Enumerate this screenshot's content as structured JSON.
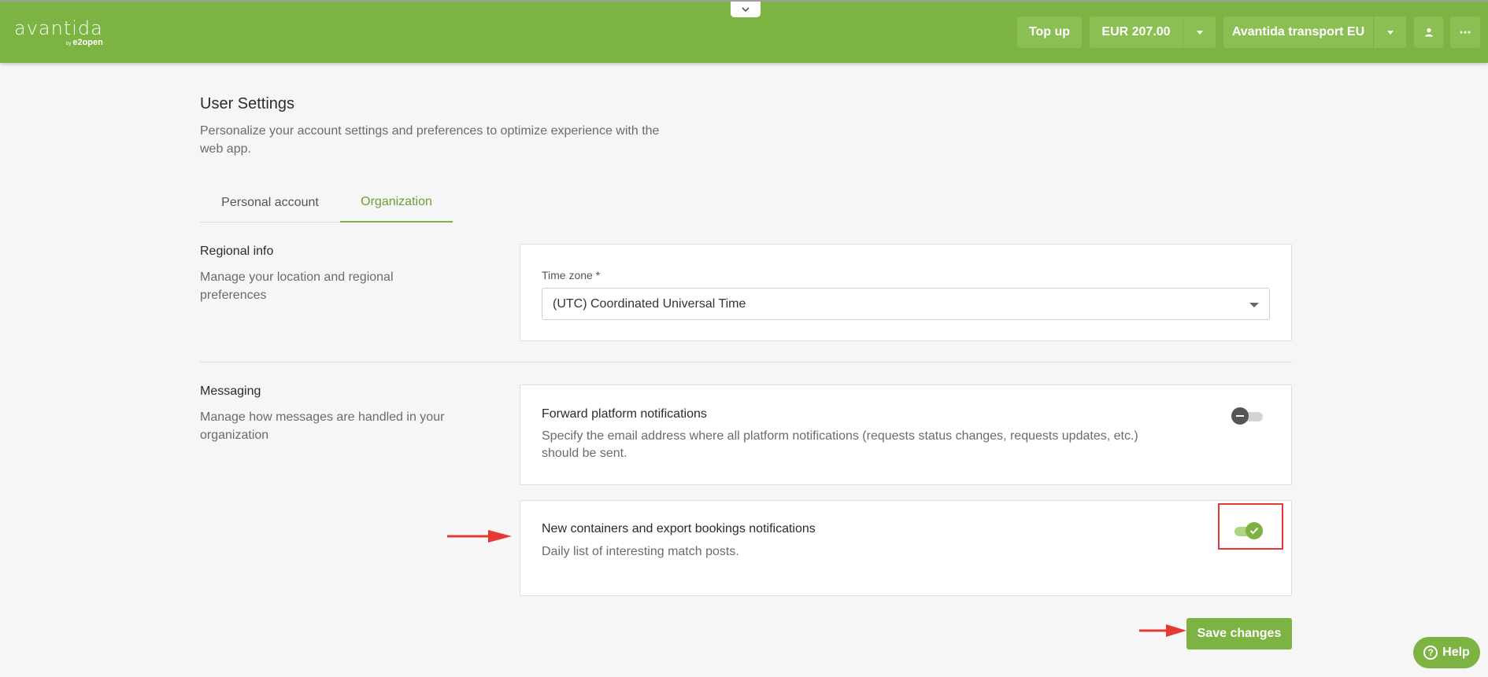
{
  "header": {
    "logo_text": "avantida",
    "logo_by": "by",
    "logo_sub": "e2open",
    "collapse_icon": "chevron-down-icon",
    "topup_label": "Top up",
    "balance_label": "EUR 207.00",
    "org_label": "Avantida transport EU",
    "user_icon": "user-icon",
    "more_icon": "more-dots-icon",
    "bar_color": "#7cb342"
  },
  "page": {
    "title": "User Settings",
    "description": "Personalize your account settings and preferences to optimize experience with the web app."
  },
  "tabs": [
    {
      "label": "Personal account",
      "active": false
    },
    {
      "label": "Organization",
      "active": true
    }
  ],
  "regional": {
    "title": "Regional info",
    "description": "Manage your location and regional preferences",
    "timezone_label": "Time zone *",
    "timezone_value": "(UTC) Coordinated Universal Time"
  },
  "messaging": {
    "title": "Messaging",
    "description": "Manage how messages are handled in your organization",
    "forward": {
      "title": "Forward platform notifications",
      "description": "Specify the email address where all platform notifications (requests status changes, requests updates, etc.) should be sent.",
      "enabled": false
    },
    "containers": {
      "title": "New containers and export bookings notifications",
      "description": "Daily list of interesting match posts.",
      "enabled": true
    }
  },
  "actions": {
    "save_label": "Save changes",
    "help_label": "Help",
    "help_icon_glyph": "?"
  },
  "annotations": {
    "arrow_color": "#e53935",
    "highlight_color": "#e53935"
  }
}
